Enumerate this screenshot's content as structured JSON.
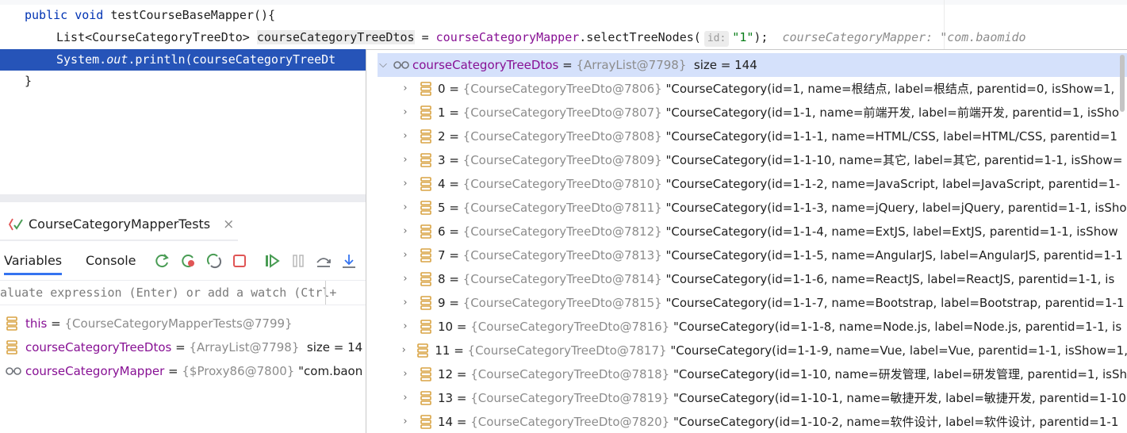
{
  "editor": {
    "line1": {
      "kw1": "public",
      "kw2": "void",
      "rest": "testCourseBaseMapper(){"
    },
    "line2": {
      "type": "List<CourseCategoryTreeDto>",
      "var": "courseCategoryTreeDtos",
      "eq": "=",
      "field": "courseCategoryMapper",
      "call": ".selectTreeNodes(",
      "hint": "id:",
      "arg": "\"1\"",
      "end": ");",
      "inlay": "courseCategoryMapper: \"com.baomido"
    },
    "line3": {
      "pre": "System.",
      "out": "out",
      "post": ".println(courseCategoryTreeDt"
    },
    "line4": {
      "text": "}"
    }
  },
  "debug": {
    "tab_title": "CourseCategoryMapperTests",
    "close": "×",
    "tabs": {
      "variables": "Variables",
      "console": "Console"
    },
    "eval_placeholder": "aluate expression (Enter) or add a watch (Ctrl+",
    "variables": [
      {
        "name": "this",
        "eq": "=",
        "type": "{CourseCategoryMapperTests@7799}",
        "value": ""
      },
      {
        "name": "courseCategoryTreeDtos",
        "eq": "=",
        "type": "{ArrayList@7798}",
        "value": "size = 14"
      },
      {
        "name": "courseCategoryMapper",
        "eq": "=",
        "type": "{$Proxy86@7800}",
        "value": "\"com.baon"
      }
    ]
  },
  "popup": {
    "root": {
      "name": "courseCategoryTreeDtos",
      "eq": "=",
      "type": "{ArrayList@7798}",
      "value": "size = 144"
    },
    "items": [
      {
        "idx": "0",
        "type": "{CourseCategoryTreeDto@7806}",
        "value": "\"CourseCategory(id=1, name=根结点, label=根结点, parentid=0, isShow=1,"
      },
      {
        "idx": "1",
        "type": "{CourseCategoryTreeDto@7807}",
        "value": "\"CourseCategory(id=1-1, name=前端开发, label=前端开发, parentid=1, isSho"
      },
      {
        "idx": "2",
        "type": "{CourseCategoryTreeDto@7808}",
        "value": "\"CourseCategory(id=1-1-1, name=HTML/CSS, label=HTML/CSS, parentid=1"
      },
      {
        "idx": "3",
        "type": "{CourseCategoryTreeDto@7809}",
        "value": "\"CourseCategory(id=1-1-10, name=其它, label=其它, parentid=1-1, isShow="
      },
      {
        "idx": "4",
        "type": "{CourseCategoryTreeDto@7810}",
        "value": "\"CourseCategory(id=1-1-2, name=JavaScript, label=JavaScript, parentid=1-"
      },
      {
        "idx": "5",
        "type": "{CourseCategoryTreeDto@7811}",
        "value": "\"CourseCategory(id=1-1-3, name=jQuery, label=jQuery, parentid=1-1, isSho"
      },
      {
        "idx": "6",
        "type": "{CourseCategoryTreeDto@7812}",
        "value": "\"CourseCategory(id=1-1-4, name=ExtJS, label=ExtJS, parentid=1-1, isShow"
      },
      {
        "idx": "7",
        "type": "{CourseCategoryTreeDto@7813}",
        "value": "\"CourseCategory(id=1-1-5, name=AngularJS, label=AngularJS, parentid=1-1"
      },
      {
        "idx": "8",
        "type": "{CourseCategoryTreeDto@7814}",
        "value": "\"CourseCategory(id=1-1-6, name=ReactJS, label=ReactJS, parentid=1-1, is"
      },
      {
        "idx": "9",
        "type": "{CourseCategoryTreeDto@7815}",
        "value": "\"CourseCategory(id=1-1-7, name=Bootstrap, label=Bootstrap, parentid=1-1"
      },
      {
        "idx": "10",
        "type": "{CourseCategoryTreeDto@7816}",
        "value": "\"CourseCategory(id=1-1-8, name=Node.js, label=Node.js, parentid=1-1, is"
      },
      {
        "idx": "11",
        "type": "{CourseCategoryTreeDto@7817}",
        "value": "\"CourseCategory(id=1-1-9, name=Vue, label=Vue, parentid=1-1, isShow=1,"
      },
      {
        "idx": "12",
        "type": "{CourseCategoryTreeDto@7818}",
        "value": "\"CourseCategory(id=1-10, name=研发管理, label=研发管理, parentid=1, isSh"
      },
      {
        "idx": "13",
        "type": "{CourseCategoryTreeDto@7819}",
        "value": "\"CourseCategory(id=1-10-1, name=敏捷开发, label=敏捷开发, parentid=1-10"
      },
      {
        "idx": "14",
        "type": "{CourseCategoryTreeDto@7820}",
        "value": "\"CourseCategory(id=1-10-2, name=软件设计, label=软件设计, parentid=1-1"
      }
    ]
  }
}
